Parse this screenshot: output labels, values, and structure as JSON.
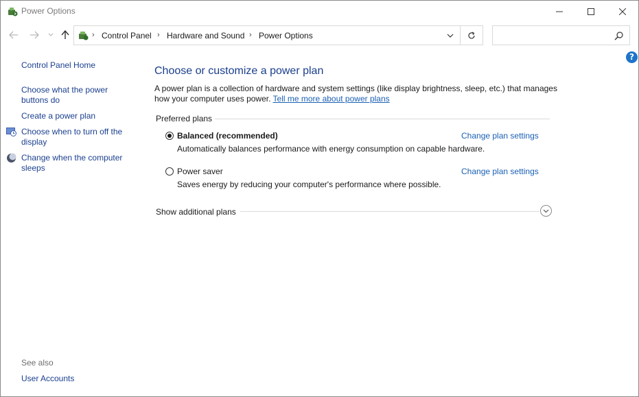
{
  "window": {
    "title": "Power Options"
  },
  "navigation": {
    "breadcrumbs": [
      "Control Panel",
      "Hardware and Sound",
      "Power Options"
    ],
    "search_placeholder": ""
  },
  "sidebar": {
    "home": "Control Panel Home",
    "links": [
      "Choose what the power buttons do",
      "Create a power plan",
      "Choose when to turn off the display",
      "Change when the computer sleeps"
    ],
    "see_also_label": "See also",
    "see_also_links": [
      "User Accounts"
    ]
  },
  "main": {
    "title": "Choose or customize a power plan",
    "description": "A power plan is a collection of hardware and system settings (like display brightness, sleep, etc.) that manages how your computer uses power.",
    "learn_more": "Tell me more about power plans",
    "preferred_label": "Preferred plans",
    "plans": [
      {
        "name": "Balanced (recommended)",
        "description": "Automatically balances performance with energy consumption on capable hardware.",
        "link": "Change plan settings",
        "selected": true
      },
      {
        "name": "Power saver",
        "description": "Saves energy by reducing your computer's performance where possible.",
        "link": "Change plan settings",
        "selected": false
      }
    ],
    "additional_label": "Show additional plans"
  },
  "icons": {
    "app": "power-options-icon",
    "help": "help-icon"
  },
  "colors": {
    "link": "#1a5fb4",
    "title": "#1a3e8c",
    "help": "#1e74c9"
  }
}
